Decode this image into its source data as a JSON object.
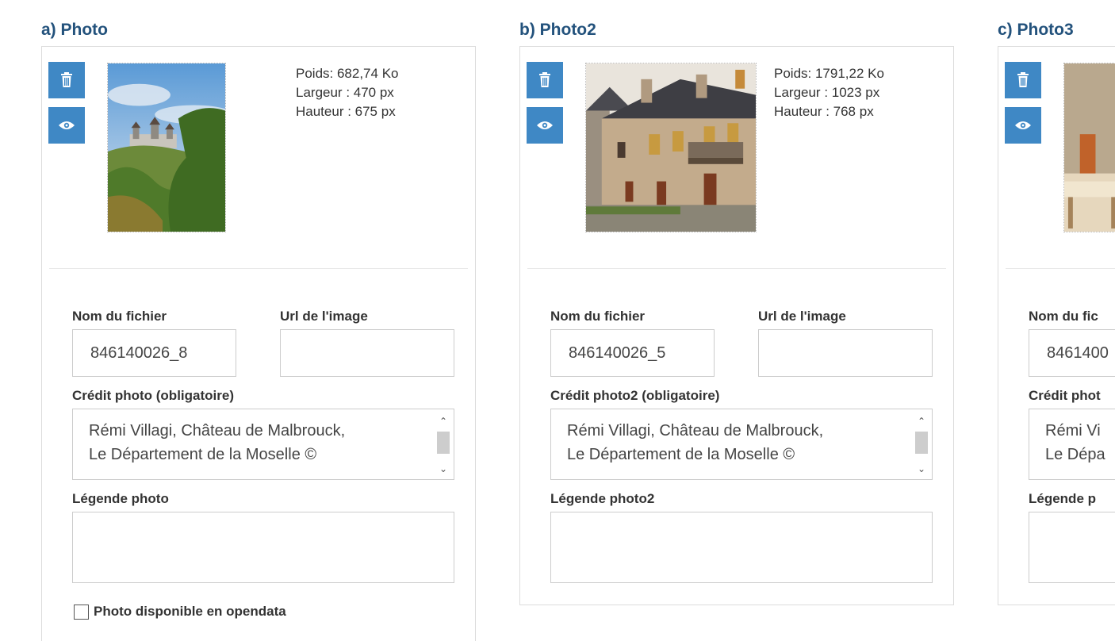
{
  "panels": [
    {
      "title": "a) Photo",
      "meta": {
        "poids": "Poids: 682,74 Ko",
        "largeur": "Largeur : 470 px",
        "hauteur": "Hauteur : 675 px"
      },
      "filename_label": "Nom du fichier",
      "filename_value": "846140026_8",
      "url_label": "Url de l'image",
      "url_value": "",
      "credit_label": "Crédit photo (obligatoire)",
      "credit_line1": "Rémi Villagi, Château de Malbrouck,",
      "credit_line2": "Le Département de la Moselle ©",
      "legend_label": "Légende photo",
      "legend_value": "",
      "opendata_label": "Photo disponible en opendata"
    },
    {
      "title": "b) Photo2",
      "meta": {
        "poids": "Poids: 1791,22 Ko",
        "largeur": "Largeur : 1023 px",
        "hauteur": "Hauteur : 768 px"
      },
      "filename_label": "Nom du fichier",
      "filename_value": "846140026_5",
      "url_label": "Url de l'image",
      "url_value": "",
      "credit_label": "Crédit photo2 (obligatoire)",
      "credit_line1": "Rémi Villagi, Château de Malbrouck,",
      "credit_line2": "Le Département de la Moselle ©",
      "legend_label": "Légende photo2",
      "legend_value": ""
    },
    {
      "title": "c) Photo3",
      "filename_label": "Nom du fic",
      "filename_value": "8461400",
      "credit_label": "Crédit phot",
      "credit_line1": "Rémi Vi",
      "credit_line2": "Le Dépa",
      "legend_label": "Légende p"
    }
  ],
  "icons": {
    "delete": "trash-icon",
    "view": "eye-icon"
  },
  "colors": {
    "accent": "#3f88c5",
    "title": "#23527c",
    "border": "#dcdcdc"
  }
}
